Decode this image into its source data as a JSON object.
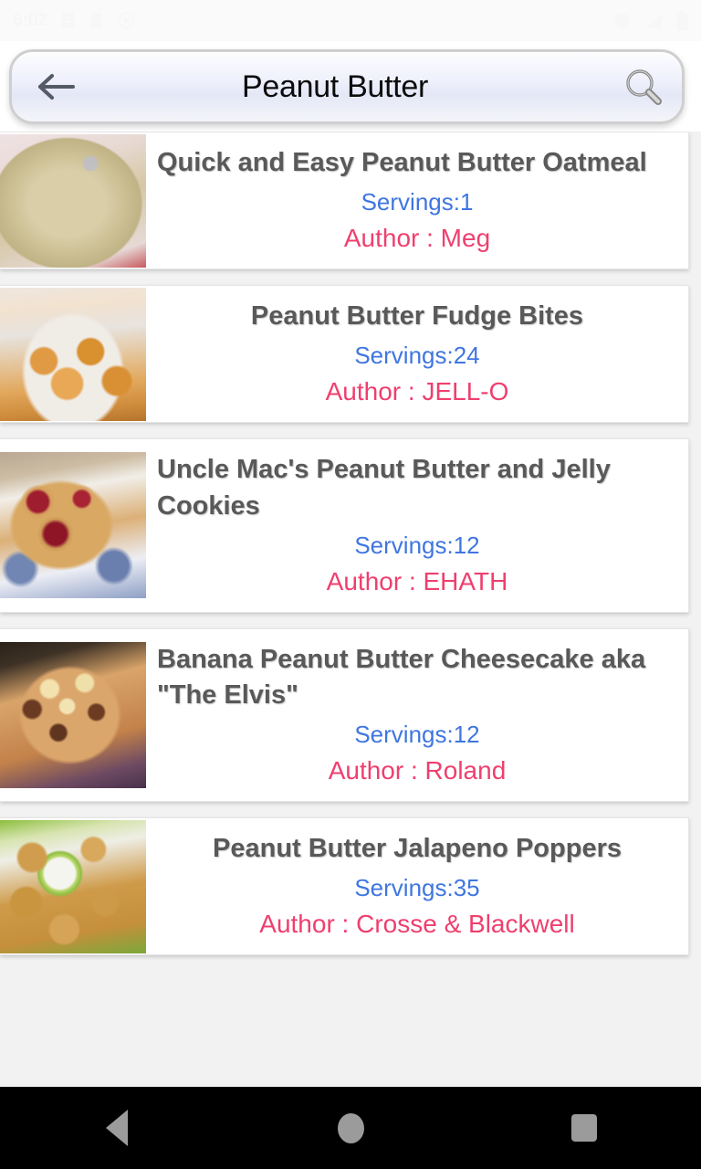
{
  "status_bar": {
    "clock": "6:02",
    "left_icons": [
      "notification-icon",
      "calendar-icon",
      "sim-icon",
      "app-icon"
    ],
    "right_icons": [
      "shield-icon",
      "signal-icon",
      "battery-icon"
    ]
  },
  "search": {
    "back_label": "back-arrow",
    "query": "Peanut Butter",
    "placeholder": "Search",
    "search_label": "search-icon"
  },
  "labels": {
    "servings_prefix": "Servings:",
    "author_prefix": "Author : "
  },
  "recipes": [
    {
      "title": "Quick and Easy Peanut Butter Oatmeal",
      "servings_text": "Servings:1",
      "author_text": "Author : Meg",
      "servings": 1,
      "author": "Meg",
      "photo": "peanut-butter-oatmeal-photo",
      "title_align": "left"
    },
    {
      "title": "Peanut Butter Fudge Bites",
      "servings_text": "Servings:24",
      "author_text": "Author : JELL-O",
      "servings": 24,
      "author": "JELL-O",
      "photo": "peanut-butter-fudge-bites-photo",
      "title_align": "center"
    },
    {
      "title": "Uncle Mac's Peanut Butter and Jelly Cookies",
      "servings_text": "Servings:12",
      "author_text": "Author : EHATH",
      "servings": 12,
      "author": "EHATH",
      "photo": "peanut-butter-jelly-cookies-photo",
      "title_align": "left"
    },
    {
      "title": "Banana Peanut Butter Cheesecake aka \"The Elvis\"",
      "servings_text": "Servings:12",
      "author_text": "Author : Roland",
      "servings": 12,
      "author": "Roland",
      "photo": "banana-peanut-butter-cheesecake-photo",
      "title_align": "left"
    },
    {
      "title": "Peanut Butter Jalapeno Poppers",
      "servings_text": "Servings:35",
      "author_text": "Author : Crosse & Blackwell",
      "servings": 35,
      "author": "Crosse & Blackwell",
      "photo": "peanut-butter-jalapeno-poppers-photo",
      "title_align": "center"
    }
  ],
  "nav_bar": {
    "back": "back-triangle-icon",
    "home": "home-circle-icon",
    "recents": "recents-square-icon"
  },
  "colors": {
    "title": "#595959",
    "servings": "#3f76e0",
    "author": "#ef3f6e",
    "card_bg": "#ffffff",
    "list_bg": "#f2f2f2",
    "nav_bg": "#000000",
    "nav_icon": "#9b9b9b"
  }
}
